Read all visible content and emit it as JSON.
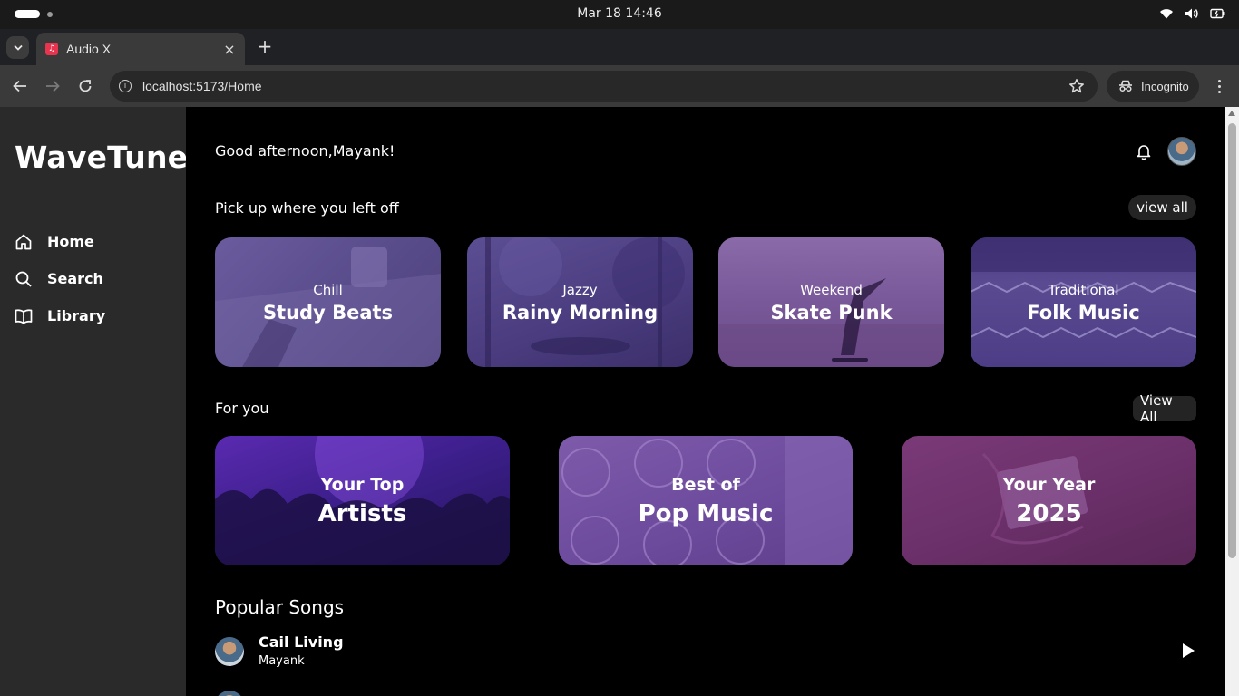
{
  "os": {
    "clock": "Mar 18  14:46"
  },
  "browser": {
    "tab_title": "Audio X",
    "tab_close": "×",
    "new_tab": "+",
    "url": "localhost:5173/Home",
    "incognito_label": "Incognito"
  },
  "sidebar": {
    "brand": "WaveTune",
    "items": [
      {
        "label": "Home",
        "icon": "home-icon"
      },
      {
        "label": "Search",
        "icon": "search-icon"
      },
      {
        "label": "Library",
        "icon": "book-icon"
      }
    ]
  },
  "header": {
    "greeting": "Good afternoon,Mayank!"
  },
  "recent": {
    "title": "Pick up where you left off",
    "view_all": "view all",
    "cards": [
      {
        "sub": "Chill",
        "title": "Study Beats"
      },
      {
        "sub": "Jazzy",
        "title": "Rainy Morning"
      },
      {
        "sub": "Weekend",
        "title": "Skate Punk"
      },
      {
        "sub": "Traditional",
        "title": "Folk Music"
      }
    ]
  },
  "for_you": {
    "title": "For you",
    "view_all": "View All",
    "cards": [
      {
        "sub": "Your Top",
        "title": "Artists"
      },
      {
        "sub": "Best of",
        "title": "Pop Music"
      },
      {
        "sub": "Your Year",
        "title": "2025"
      }
    ]
  },
  "popular": {
    "title": "Popular Songs",
    "songs": [
      {
        "name": "Cail Living",
        "artist": "Mayank"
      }
    ]
  },
  "colors": {
    "sidebar_bg": "#2a2a2a",
    "main_bg": "#000000",
    "accent_purple": "#5a4d8c"
  }
}
